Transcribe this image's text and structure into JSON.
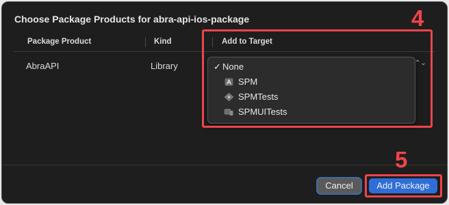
{
  "dialog": {
    "title": "Choose Package Products for abra-api-ios-package"
  },
  "table": {
    "columns": [
      "Package Product",
      "Kind",
      "Add to Target"
    ],
    "rows": [
      {
        "product": "AbraAPI",
        "kind": "Library"
      }
    ]
  },
  "target_menu": {
    "items": [
      {
        "label": "None",
        "checked": true,
        "icon": null
      },
      {
        "label": "SPM",
        "checked": false,
        "icon": "app-target-icon"
      },
      {
        "label": "SPMTests",
        "checked": false,
        "icon": "test-target-icon"
      },
      {
        "label": "SPMUITests",
        "checked": false,
        "icon": "ui-test-target-icon"
      }
    ],
    "checkmark": "✓",
    "stepper": "⌃⌄"
  },
  "annotations": {
    "step4": "4",
    "step5": "5",
    "color": "#f0444b"
  },
  "buttons": {
    "cancel": "Cancel",
    "add_package": "Add Package"
  },
  "colors": {
    "dialog_bg": "#1e1e1e",
    "accent": "#2f6ed8"
  }
}
